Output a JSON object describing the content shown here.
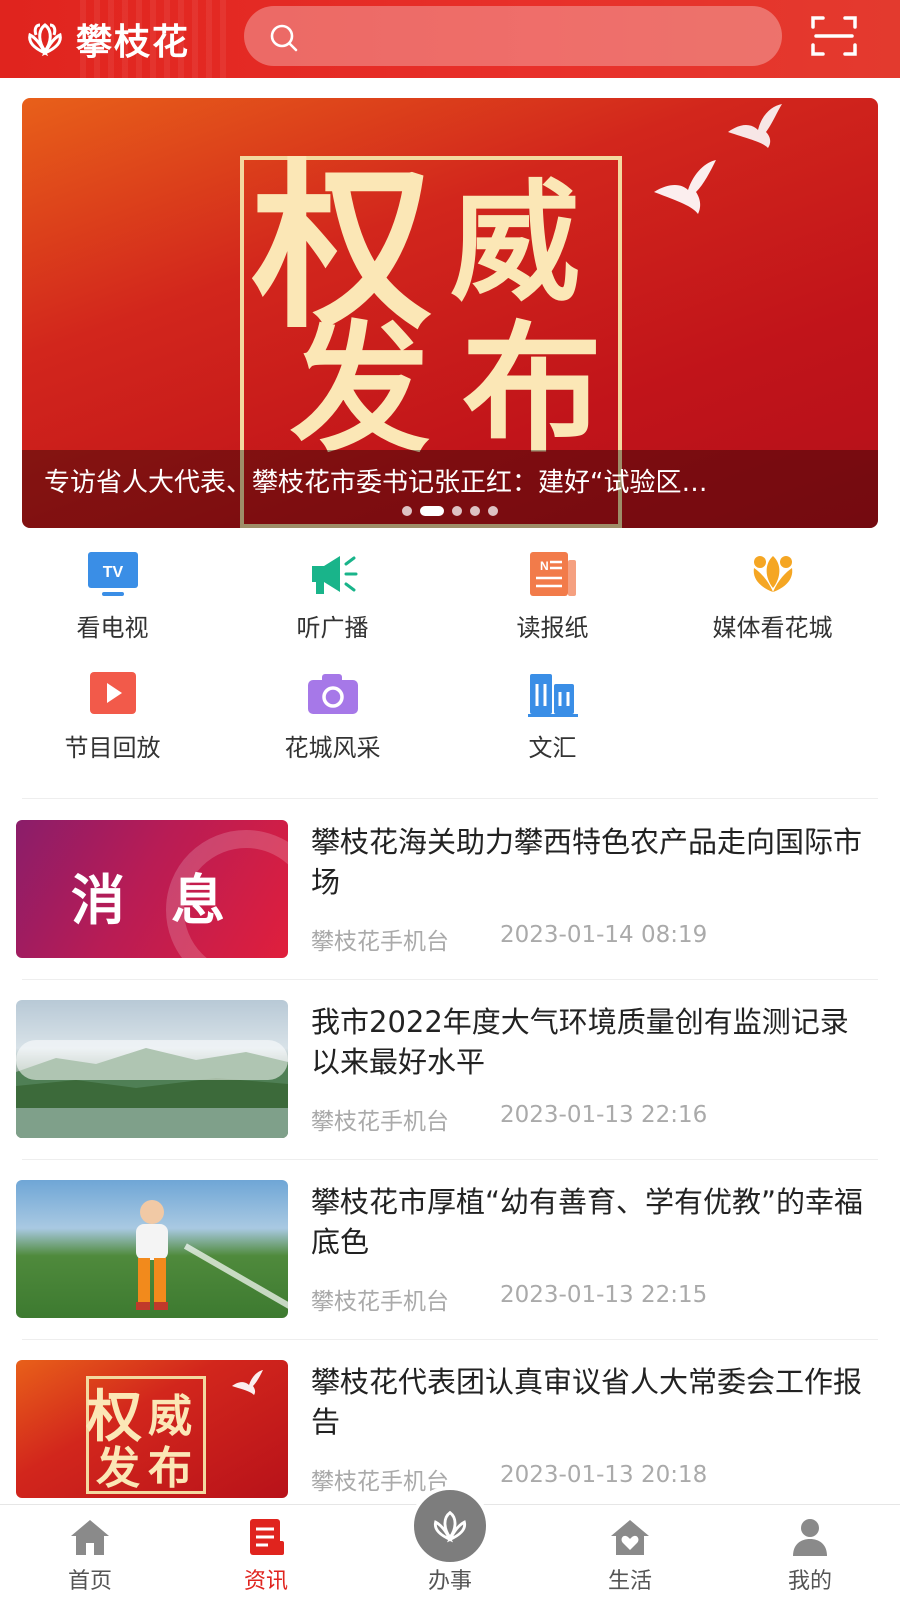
{
  "app": {
    "name": "攀枝花"
  },
  "search": {
    "placeholder": ""
  },
  "banner": {
    "image_text": [
      "权",
      "威",
      "发",
      "布"
    ],
    "caption": "专访省人大代表、攀枝花市委书记张正红：建好“试验区…",
    "slides": 5,
    "active_slide": 2
  },
  "shortcuts": [
    {
      "label": "看电视",
      "icon": "tv-icon",
      "color": "#3a8ee6"
    },
    {
      "label": "听广播",
      "icon": "megaphone-icon",
      "color": "#19b48a"
    },
    {
      "label": "读报纸",
      "icon": "newspaper-icon",
      "color": "#f27b4a"
    },
    {
      "label": "媒体看花城",
      "icon": "flower-icon",
      "color": "#f5a623"
    },
    {
      "label": "节目回放",
      "icon": "play-icon",
      "color": "#f25a4a"
    },
    {
      "label": "花城风采",
      "icon": "camera-icon",
      "color": "#a678e8"
    },
    {
      "label": "文汇",
      "icon": "buildings-icon",
      "color": "#3a8ee6"
    }
  ],
  "news": [
    {
      "title": "攀枝花海关助力攀西特色农产品走向国际市场",
      "source": "攀枝花手机台",
      "time": "2023-01-14 08:19",
      "thumb_text": "消息"
    },
    {
      "title": "我市2022年度大气环境质量创有监测记录以来最好水平",
      "source": "攀枝花手机台",
      "time": "2023-01-13 22:16"
    },
    {
      "title": "攀枝花市厚植“幼有善育、学有优教”的幸福底色",
      "source": "攀枝花手机台",
      "time": "2023-01-13 22:15"
    },
    {
      "title": "攀枝花代表团认真审议省人大常委会工作报告",
      "source": "攀枝花手机台",
      "time": "2023-01-13 20:18",
      "thumb_text": [
        "权",
        "威",
        "发",
        "布"
      ]
    }
  ],
  "tabbar": [
    {
      "label": "首页",
      "icon": "home-icon"
    },
    {
      "label": "资讯",
      "icon": "news-icon",
      "active": true
    },
    {
      "label": "办事",
      "icon": "flower-logo-icon"
    },
    {
      "label": "生活",
      "icon": "house-heart-icon"
    },
    {
      "label": "我的",
      "icon": "user-icon"
    }
  ],
  "colors": {
    "brand_red": "#e0241e",
    "muted_text": "#aaaaaa",
    "title_text": "#222222"
  }
}
